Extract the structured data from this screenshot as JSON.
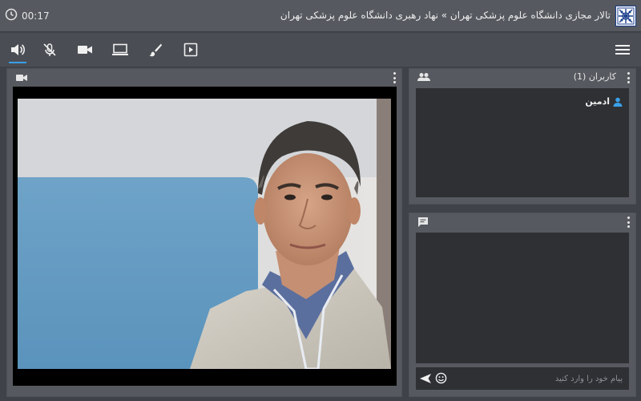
{
  "header": {
    "timer": "00:17",
    "title": "تالار مجازی دانشگاه علوم پزشکی تهران » نهاد رهبری دانشگاه علوم پزشکی تهران",
    "logo_icon": "university-logo-icon"
  },
  "toolbar": {
    "items": [
      {
        "name": "speaker-icon",
        "active": true
      },
      {
        "name": "microphone-off-icon",
        "active": false
      },
      {
        "name": "camera-icon",
        "active": false
      },
      {
        "name": "screen-share-icon",
        "active": false
      },
      {
        "name": "whiteboard-brush-icon",
        "active": false
      },
      {
        "name": "media-play-icon",
        "active": false
      }
    ],
    "menu_icon": "hamburger-menu-icon"
  },
  "video_panel": {
    "header_icon": "video-camera-icon"
  },
  "users_panel": {
    "title": "کاربران (1)",
    "header_icon": "users-icon",
    "users": [
      {
        "name": "ادمین",
        "icon": "user-icon"
      }
    ]
  },
  "chat_panel": {
    "header_icon": "chat-icon",
    "input_placeholder": "پیام خود را وارد کنید",
    "send_icon": "send-icon",
    "emoji_icon": "emoji-icon"
  },
  "colors": {
    "topbar": "#56595f",
    "toolbar": "#4a4d53",
    "background": "#3f4248",
    "panel_body": "#2e3034",
    "accent": "#3aa0e8"
  }
}
